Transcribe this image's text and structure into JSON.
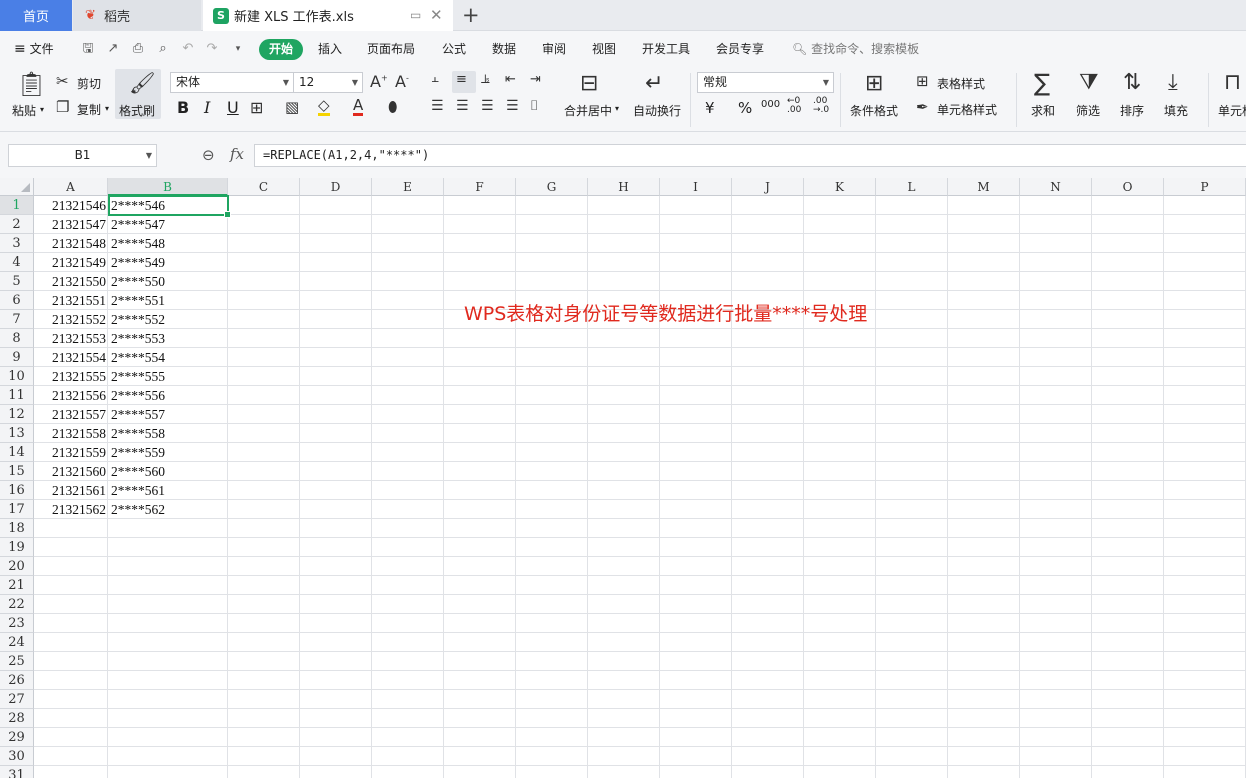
{
  "tabs": {
    "home": "首页",
    "daoke": "稻壳",
    "document": "新建 XLS 工作表.xls",
    "doc_badge": "S"
  },
  "menu": {
    "file": "文件",
    "items": [
      "开始",
      "插入",
      "页面布局",
      "公式",
      "数据",
      "审阅",
      "视图",
      "开发工具",
      "会员专享"
    ],
    "search_placeholder": "查找命令、搜索模板"
  },
  "ribbon": {
    "paste": "粘贴",
    "cut": "剪切",
    "copy": "复制",
    "format_painter": "格式刷",
    "font_name": "宋体",
    "font_size": "12",
    "bold": "B",
    "italic": "I",
    "underline": "U",
    "merge_center": "合并居中",
    "wrap_text": "自动换行",
    "number_format": "常规",
    "currency": "¥",
    "percent": "%",
    "thousands": "000",
    "decimal_inc": "←0\n.00",
    "decimal_dec": ".00\n→.0",
    "conditional_format": "条件格式",
    "table_style": "表格样式",
    "cell_style": "单元格样式",
    "sum": "求和",
    "filter": "筛选",
    "sort": "排序",
    "fill": "填充",
    "cell": "单元格"
  },
  "formula_bar": {
    "name_box": "B1",
    "fx": "fx",
    "formula": "=REPLACE(A1,2,4,\"****\")"
  },
  "sheet": {
    "columns": [
      "A",
      "B",
      "C",
      "D",
      "E",
      "F",
      "G",
      "H",
      "I",
      "J",
      "K",
      "L",
      "M",
      "N",
      "O",
      "P"
    ],
    "active_column": "B",
    "active_row": 1,
    "row_numbers": [
      "1",
      "2",
      "3",
      "4",
      "5",
      "6",
      "7",
      "8",
      "9",
      "10",
      "11",
      "12",
      "13",
      "14",
      "15",
      "16",
      "17",
      "18",
      "19",
      "20",
      "21",
      "22",
      "23",
      "24",
      "25",
      "26",
      "27",
      "28",
      "29",
      "30",
      "31"
    ],
    "col_a": [
      "21321546",
      "21321547",
      "21321548",
      "21321549",
      "21321550",
      "21321551",
      "21321552",
      "21321553",
      "21321554",
      "21321555",
      "21321556",
      "21321557",
      "21321558",
      "21321559",
      "21321560",
      "21321561",
      "21321562"
    ],
    "col_b": [
      "2****546",
      "2****547",
      "2****548",
      "2****549",
      "2****550",
      "2****551",
      "2****552",
      "2****553",
      "2****554",
      "2****555",
      "2****556",
      "2****557",
      "2****558",
      "2****559",
      "2****560",
      "2****561",
      "2****562"
    ],
    "annotation": "WPS表格对身份证号等数据进行批量****号处理"
  },
  "colors": {
    "accent_green": "#1fa561",
    "home_tab_blue": "#4a7fe6",
    "annotation_red": "#e0291e"
  }
}
